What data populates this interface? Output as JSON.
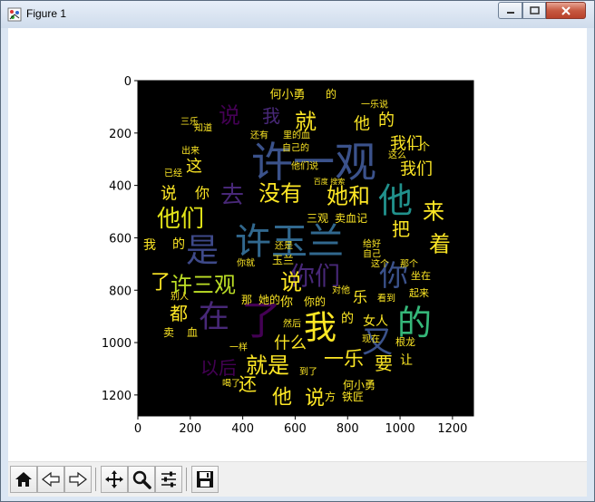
{
  "window": {
    "title": "Figure 1"
  },
  "plot": {
    "x_ticks": [
      "0",
      "200",
      "400",
      "600",
      "800",
      "1000",
      "1200"
    ],
    "y_ticks": [
      "0",
      "200",
      "400",
      "600",
      "800",
      "1000",
      "1200"
    ],
    "x_range": [
      0,
      1280
    ],
    "y_range": [
      0,
      1280
    ],
    "background": "#000000"
  },
  "wordcloud": {
    "words": [
      {
        "t": "许一观",
        "x": 345,
        "y": 178,
        "s": 46,
        "c": "#3b528b"
      },
      {
        "t": "他",
        "x": 435,
        "y": 220,
        "s": 38,
        "c": "#21918c"
      },
      {
        "t": "许玉兰",
        "x": 318,
        "y": 265,
        "s": 40,
        "c": "#31688e"
      },
      {
        "t": "是",
        "x": 222,
        "y": 275,
        "s": 36,
        "c": "#3e4989"
      },
      {
        "t": "你们",
        "x": 346,
        "y": 303,
        "s": 28,
        "c": "#482878"
      },
      {
        "t": "你",
        "x": 433,
        "y": 303,
        "s": 32,
        "c": "#3b528b"
      },
      {
        "t": "在",
        "x": 235,
        "y": 348,
        "s": 34,
        "c": "#482878"
      },
      {
        "t": "了",
        "x": 287,
        "y": 352,
        "s": 44,
        "c": "#440154"
      },
      {
        "t": "我",
        "x": 352,
        "y": 360,
        "s": 36,
        "c": "#fde725"
      },
      {
        "t": "的",
        "x": 456,
        "y": 355,
        "s": 38,
        "c": "#35b779"
      },
      {
        "t": "又",
        "x": 415,
        "y": 376,
        "s": 34,
        "c": "#3b528b"
      },
      {
        "t": "他们",
        "x": 198,
        "y": 240,
        "s": 26,
        "c": "#e2e418"
      },
      {
        "t": "没有",
        "x": 308,
        "y": 212,
        "s": 24,
        "c": "#fde725"
      },
      {
        "t": "她和",
        "x": 383,
        "y": 215,
        "s": 24,
        "c": "#fde725"
      },
      {
        "t": "就",
        "x": 336,
        "y": 133,
        "s": 24,
        "c": "#fde725"
      },
      {
        "t": "去",
        "x": 255,
        "y": 214,
        "s": 26,
        "c": "#482878"
      },
      {
        "t": "说",
        "x": 252,
        "y": 126,
        "s": 24,
        "c": "#440154"
      },
      {
        "t": "我",
        "x": 298,
        "y": 127,
        "s": 20,
        "c": "#482878"
      },
      {
        "t": "许三观",
        "x": 223,
        "y": 313,
        "s": 24,
        "c": "#bddf26"
      },
      {
        "t": "了",
        "x": 176,
        "y": 310,
        "s": 22,
        "c": "#fde725"
      },
      {
        "t": "说",
        "x": 320,
        "y": 310,
        "s": 24,
        "c": "#fde725"
      },
      {
        "t": "着",
        "x": 484,
        "y": 268,
        "s": 24,
        "c": "#fde725"
      },
      {
        "t": "来",
        "x": 477,
        "y": 232,
        "s": 24,
        "c": "#fde725"
      },
      {
        "t": "把",
        "x": 441,
        "y": 252,
        "s": 20,
        "c": "#fde725"
      },
      {
        "t": "就是",
        "x": 294,
        "y": 402,
        "s": 24,
        "c": "#fde725"
      },
      {
        "t": "一乐",
        "x": 378,
        "y": 395,
        "s": 22,
        "c": "#fde725"
      },
      {
        "t": "以后",
        "x": 240,
        "y": 405,
        "s": 20,
        "c": "#440154"
      },
      {
        "t": "他",
        "x": 310,
        "y": 437,
        "s": 22,
        "c": "#fde725"
      },
      {
        "t": "说",
        "x": 346,
        "y": 438,
        "s": 22,
        "c": "#fde725"
      },
      {
        "t": "还",
        "x": 272,
        "y": 423,
        "s": 20,
        "c": "#fde725"
      },
      {
        "t": "都",
        "x": 196,
        "y": 345,
        "s": 20,
        "c": "#fde725"
      },
      {
        "t": "要",
        "x": 422,
        "y": 400,
        "s": 20,
        "c": "#fde725"
      },
      {
        "t": "什么",
        "x": 319,
        "y": 377,
        "s": 18,
        "c": "#fde725"
      },
      {
        "t": "我们",
        "x": 447,
        "y": 157,
        "s": 18,
        "c": "#fde725"
      },
      {
        "t": "我们",
        "x": 458,
        "y": 185,
        "s": 18,
        "c": "#fde725"
      },
      {
        "t": "这",
        "x": 213,
        "y": 182,
        "s": 18,
        "c": "#fde725"
      },
      {
        "t": "的",
        "x": 425,
        "y": 131,
        "s": 18,
        "c": "#fde725"
      },
      {
        "t": "他",
        "x": 398,
        "y": 135,
        "s": 18,
        "c": "#fde725"
      },
      {
        "t": "说",
        "x": 185,
        "y": 212,
        "s": 18,
        "c": "#fde725"
      },
      {
        "t": "你",
        "x": 222,
        "y": 212,
        "s": 16,
        "c": "#fde725"
      },
      {
        "t": "何小勇",
        "x": 316,
        "y": 103,
        "s": 13,
        "c": "#fde725"
      },
      {
        "t": "的",
        "x": 364,
        "y": 103,
        "s": 12,
        "c": "#fde725"
      },
      {
        "t": "一个",
        "x": 461,
        "y": 161,
        "s": 12,
        "c": "#fde725"
      },
      {
        "t": "卖血记",
        "x": 386,
        "y": 240,
        "s": 12,
        "c": "#fde725"
      },
      {
        "t": "三观",
        "x": 349,
        "y": 240,
        "s": 12,
        "c": "#fde725"
      },
      {
        "t": "玉兰",
        "x": 311,
        "y": 286,
        "s": 12,
        "c": "#fde725"
      },
      {
        "t": "我",
        "x": 164,
        "y": 269,
        "s": 14,
        "c": "#fde725"
      },
      {
        "t": "的",
        "x": 196,
        "y": 268,
        "s": 14,
        "c": "#fde725"
      },
      {
        "t": "女人",
        "x": 413,
        "y": 353,
        "s": 14,
        "c": "#fde725"
      },
      {
        "t": "乐",
        "x": 396,
        "y": 327,
        "s": 16,
        "c": "#fde725"
      },
      {
        "t": "何小勇",
        "x": 395,
        "y": 424,
        "s": 12,
        "c": "#fde725"
      },
      {
        "t": "铁匠",
        "x": 388,
        "y": 437,
        "s": 12,
        "c": "#fde725"
      },
      {
        "t": "方",
        "x": 363,
        "y": 437,
        "s": 12,
        "c": "#fde725"
      },
      {
        "t": "根龙",
        "x": 446,
        "y": 376,
        "s": 11,
        "c": "#fde725"
      },
      {
        "t": "起来",
        "x": 461,
        "y": 322,
        "s": 11,
        "c": "#fde725"
      },
      {
        "t": "让",
        "x": 447,
        "y": 396,
        "s": 14,
        "c": "#fde725"
      },
      {
        "t": "坐在",
        "x": 463,
        "y": 303,
        "s": 11,
        "c": "#fde725"
      },
      {
        "t": "他们说",
        "x": 335,
        "y": 182,
        "s": 10,
        "c": "#fde725"
      },
      {
        "t": "自己的",
        "x": 325,
        "y": 162,
        "s": 10,
        "c": "#fde725"
      },
      {
        "t": "还有",
        "x": 285,
        "y": 148,
        "s": 10,
        "c": "#fde725"
      },
      {
        "t": "里的血",
        "x": 326,
        "y": 148,
        "s": 10,
        "c": "#fde725"
      },
      {
        "t": "这么",
        "x": 437,
        "y": 170,
        "s": 10,
        "c": "#fde725"
      },
      {
        "t": "三乐",
        "x": 208,
        "y": 133,
        "s": 10,
        "c": "#fde725"
      },
      {
        "t": "知道",
        "x": 223,
        "y": 140,
        "s": 10,
        "c": "#fde725"
      },
      {
        "t": "出来",
        "x": 209,
        "y": 165,
        "s": 10,
        "c": "#fde725"
      },
      {
        "t": "已经",
        "x": 190,
        "y": 190,
        "s": 10,
        "c": "#fde725"
      },
      {
        "t": "一乐说",
        "x": 412,
        "y": 114,
        "s": 10,
        "c": "#fde725"
      },
      {
        "t": "看到",
        "x": 425,
        "y": 328,
        "s": 10,
        "c": "#fde725"
      },
      {
        "t": "现在",
        "x": 408,
        "y": 373,
        "s": 10,
        "c": "#fde725"
      },
      {
        "t": "自己",
        "x": 409,
        "y": 279,
        "s": 10,
        "c": "#fde725"
      },
      {
        "t": "这个",
        "x": 418,
        "y": 290,
        "s": 10,
        "c": "#fde725"
      },
      {
        "t": "那个",
        "x": 450,
        "y": 290,
        "s": 10,
        "c": "#fde725"
      },
      {
        "t": "给好",
        "x": 409,
        "y": 268,
        "s": 10,
        "c": "#fde725"
      },
      {
        "t": "还是",
        "x": 312,
        "y": 270,
        "s": 10,
        "c": "#fde725"
      },
      {
        "t": "然后",
        "x": 321,
        "y": 356,
        "s": 10,
        "c": "#fde725"
      },
      {
        "t": "到了",
        "x": 339,
        "y": 409,
        "s": 10,
        "c": "#fde725"
      },
      {
        "t": "一样",
        "x": 262,
        "y": 382,
        "s": 10,
        "c": "#fde725"
      },
      {
        "t": "喝了",
        "x": 254,
        "y": 422,
        "s": 10,
        "c": "#fde725"
      },
      {
        "t": "卖",
        "x": 185,
        "y": 366,
        "s": 12,
        "c": "#fde725"
      },
      {
        "t": "血",
        "x": 211,
        "y": 366,
        "s": 12,
        "c": "#fde725"
      },
      {
        "t": "别人",
        "x": 197,
        "y": 326,
        "s": 10,
        "c": "#fde725"
      },
      {
        "t": "那",
        "x": 271,
        "y": 330,
        "s": 12,
        "c": "#fde725"
      },
      {
        "t": "她的",
        "x": 296,
        "y": 330,
        "s": 12,
        "c": "#fde725"
      },
      {
        "t": "你的",
        "x": 346,
        "y": 332,
        "s": 12,
        "c": "#fde725"
      },
      {
        "t": "对他",
        "x": 375,
        "y": 319,
        "s": 10,
        "c": "#fde725"
      },
      {
        "t": "你就",
        "x": 270,
        "y": 289,
        "s": 10,
        "c": "#fde725"
      },
      {
        "t": "你",
        "x": 315,
        "y": 332,
        "s": 14,
        "c": "#fde725"
      },
      {
        "t": "的",
        "x": 382,
        "y": 350,
        "s": 14,
        "c": "#fde725"
      },
      {
        "t": "百度 搜索",
        "x": 362,
        "y": 199,
        "s": 8,
        "c": "#fde725"
      }
    ]
  },
  "toolbar": {
    "buttons": [
      "home-icon",
      "back-icon",
      "forward-icon",
      "pan-icon",
      "zoom-icon",
      "configure-icon",
      "save-icon"
    ]
  }
}
